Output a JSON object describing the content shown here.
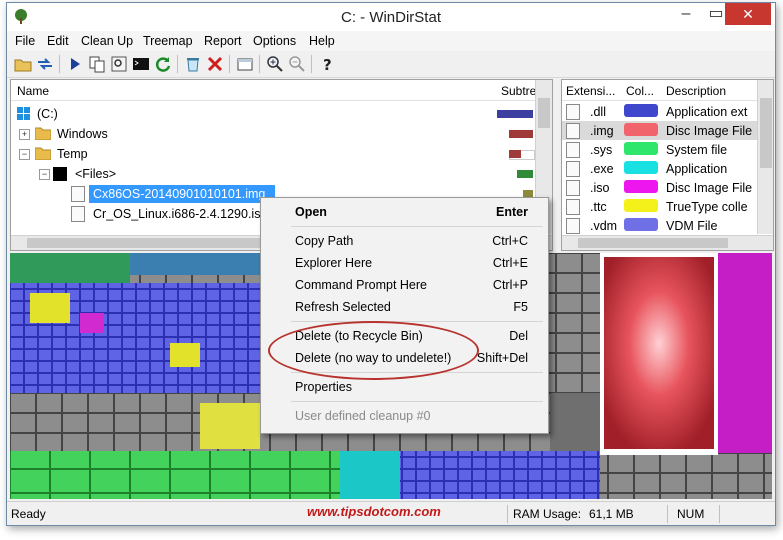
{
  "window": {
    "title": "C: - WinDirStat"
  },
  "menu": [
    "File",
    "Edit",
    "Clean Up",
    "Treemap",
    "Report",
    "Options",
    "Help"
  ],
  "toolbar": [
    "open-icon",
    "refresh-icon",
    "play-icon",
    "copy-icon",
    "explorer-icon",
    "cmd-icon",
    "refresh-selected-icon",
    "recycle-icon",
    "delete-icon",
    "properties-icon",
    "zoom-in-icon",
    "zoom-out-icon",
    "help-icon"
  ],
  "tree": {
    "headers": {
      "name": "Name",
      "subtree": "Subtre"
    },
    "rows": [
      {
        "label": "(C:)"
      },
      {
        "label": "Windows"
      },
      {
        "label": "Temp"
      },
      {
        "label": "<Files>"
      },
      {
        "label": "Cx86OS-20140901010101.img"
      },
      {
        "label": "Cr_OS_Linux.i686-2.4.1290.iso"
      }
    ]
  },
  "extensions": {
    "headers": {
      "ext": "Extensi...",
      "color": "Col...",
      "desc": "Description"
    },
    "rows": [
      {
        "ext": ".dll",
        "color": "#3f47cc",
        "desc": "Application ext"
      },
      {
        "ext": ".img",
        "color": "#f2646c",
        "desc": "Disc Image File"
      },
      {
        "ext": ".sys",
        "color": "#2fe66c",
        "desc": "System file"
      },
      {
        "ext": ".exe",
        "color": "#19e1e1",
        "desc": "Application"
      },
      {
        "ext": ".iso",
        "color": "#ee16ee",
        "desc": "Disc Image File"
      },
      {
        "ext": ".ttc",
        "color": "#f4f01a",
        "desc": "TrueType colle"
      },
      {
        "ext": ".vdm",
        "color": "#6f6fe6",
        "desc": "VDM File"
      }
    ]
  },
  "context_menu": {
    "items": [
      {
        "label": "Open",
        "key": "Enter"
      },
      {
        "label": "Copy Path",
        "key": "Ctrl+C"
      },
      {
        "label": "Explorer Here",
        "key": "Ctrl+E"
      },
      {
        "label": "Command Prompt Here",
        "key": "Ctrl+P"
      },
      {
        "label": "Refresh Selected",
        "key": "F5"
      },
      {
        "label": "Delete (to Recycle Bin)",
        "key": "Del"
      },
      {
        "label": "Delete (no way to undelete!)",
        "key": "Shift+Del"
      },
      {
        "label": "Properties",
        "key": ""
      },
      {
        "label": "User defined cleanup #0",
        "key": ""
      }
    ]
  },
  "status": {
    "text": "Ready",
    "watermark": "www.tipsdotcom.com",
    "ram_label": "RAM Usage:",
    "ram_value": "61,1 MB",
    "num": "NUM"
  }
}
